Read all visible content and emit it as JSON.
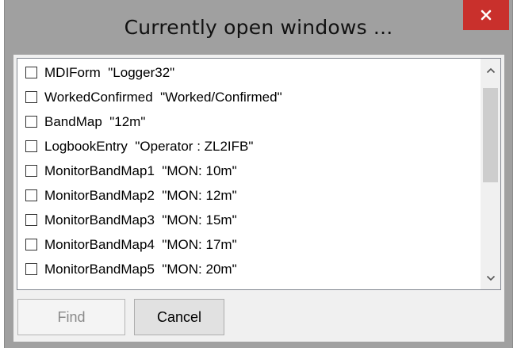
{
  "window": {
    "title": "Currently open windows ...",
    "close_symbol": "×",
    "close_color": "#c9302c"
  },
  "list": {
    "items": [
      {
        "label": "MDIForm  \"Logger32\"",
        "checked": false
      },
      {
        "label": "WorkedConfirmed  \"Worked/Confirmed\"",
        "checked": false
      },
      {
        "label": "BandMap  \"12m\"",
        "checked": false
      },
      {
        "label": "LogbookEntry  \"Operator : ZL2IFB\"",
        "checked": false
      },
      {
        "label": "MonitorBandMap1  \"MON: 10m\"",
        "checked": false
      },
      {
        "label": "MonitorBandMap2  \"MON: 12m\"",
        "checked": false
      },
      {
        "label": "MonitorBandMap3  \"MON: 15m\"",
        "checked": false
      },
      {
        "label": "MonitorBandMap4  \"MON: 17m\"",
        "checked": false
      },
      {
        "label": "MonitorBandMap5  \"MON: 20m\"",
        "checked": false
      }
    ]
  },
  "scrollbar": {
    "up_icon": "chevron-up-icon",
    "down_icon": "chevron-down-icon"
  },
  "buttons": {
    "find_label": "Find",
    "find_enabled": false,
    "cancel_label": "Cancel"
  }
}
